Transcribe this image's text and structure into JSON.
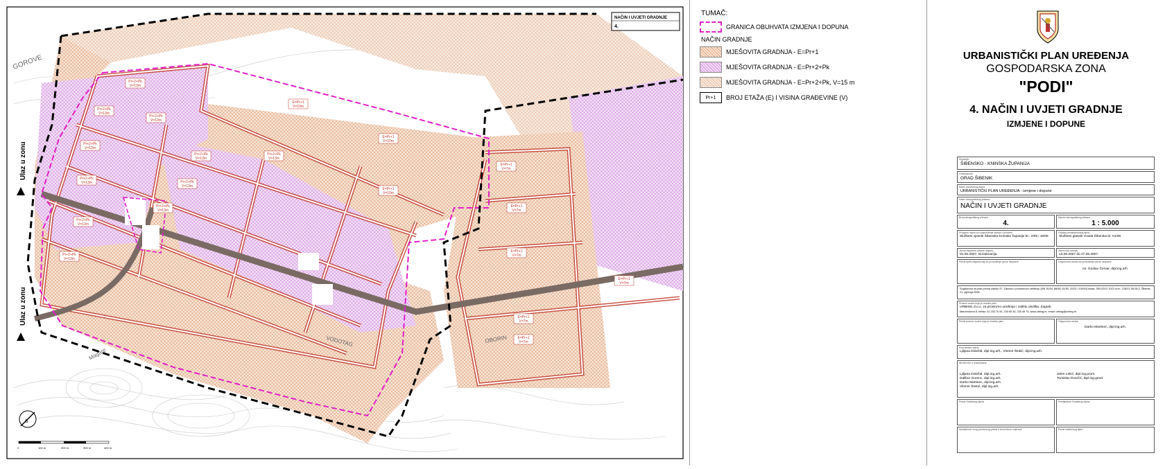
{
  "map": {
    "stamp": {
      "title": "NAČIN I UVJETI GRADNJE",
      "number": "4."
    },
    "road_labels": {
      "entry_top": "Ulaz u zonu",
      "entry_bottom": "Ulaz u zonu"
    },
    "place_labels": [
      "GOROVE",
      "Magare",
      "OBORIN",
      "VODOTAG"
    ],
    "zone_labels": [
      "Pr+2+Pk V=13m",
      "Pr+2+Pk V=13m",
      "Pr+2+Pk V=13m",
      "E=Pr+1 V=10m",
      "E=Pr+1 V=10m",
      "Pr+2+Pk V=13m",
      "Pr+2+Pk V=13m",
      "Pr+2+Pk V=13m",
      "E=Pr+1 V=10m",
      "Pr+2+Pk V=13m",
      "Pr+2+Pk V=13m",
      "Pr+2+Pk V=13m",
      "Pr+2+Pk V=13m",
      "Pr+2+Pk V=13m",
      "E=Pr+1 V=7m",
      "E=Pr+1 V=7m",
      "E=Pr+1 V=7m",
      "E=Pr+1 V=7m",
      "E=Pr+1 V=7m",
      "E=Pr+1 V=7m"
    ],
    "scale_labels": [
      "0",
      "100 m",
      "200 m",
      "300 m",
      "400 m"
    ],
    "north_label": "S"
  },
  "legend": {
    "title": "TUMAČ:",
    "boundary_label": "GRANICA OBUHVATA IZMJENA I DOPUNA",
    "section_label": "NAČIN GRADNJE",
    "items": [
      {
        "label": "MJEŠOVITA GRADNJA - E=Pr+1",
        "color": "#e6a47a"
      },
      {
        "label": "MJEŠOVITA GRADNJA - E=Pr+2+Pk",
        "color": "#d68fe0"
      },
      {
        "label": "MJEŠOVITA GRADNJA - E=Pr+2+Pk, V=15 m",
        "color": "#e6b99a"
      }
    ],
    "floors_badge": "Pr+1",
    "floors_label": "BROJ ETAŽA (E) I VISINA GRAĐEVINE (V)"
  },
  "title_block": {
    "line1": "URBANISTIČKI PLAN UREĐENJA",
    "line2": "GOSPODARSKA ZONA",
    "line3": "\"PODI\"",
    "line4": "4. NAČIN I UVJETI GRADNJE",
    "line5": "IZMJENE I DOPUNE",
    "rows": [
      {
        "caption": "Županija",
        "value": "ŠIBENSKO - KNINSKA ŽUPANIJA"
      },
      {
        "caption": "Grad/općina",
        "value": "GRAD ŠIBENIK"
      },
      {
        "caption": "Naziv prostornog plana",
        "value": "URBANISTIČKI PLAN UREĐENJA - izmjene i dopune"
      },
      {
        "caption": "Naziv kartografskog prikaza",
        "value": "NAČIN I UVJETI GRADNJE"
      }
    ],
    "number_caption": "Broj kartografskog prikaza",
    "number_value": "4.",
    "scale_caption": "Mjerilo kartografskog prikaza",
    "scale_value": "1 : 5.000",
    "decision_caption": "Program mjera za unapređenje stanja u prostoru",
    "decision_value": "Službeni vjesnik Šibensko-Kninske županije br.: 2/05 i 15/06",
    "publication_caption": "Odluka predstavničkog tijela",
    "publication_value": "Službeni glasnik Grada Šibenika br. 01/08",
    "public_debate_caption": "Javna rasprava (datum objave)",
    "public_debate_value": "01.06.2007. Sl.Dalmacija",
    "public_insight_caption": "Javni uvid održan",
    "public_insight_value": "13.06.2007 do 27.06.2007.",
    "stamp_caption": "Pečat tijela odgovornog za provođenje javne rasprave",
    "responsible_caption": "Odgovorna osoba za provođenje javne rasprave",
    "responsible_name": "mr. Gustav Červar, dipl.ing.arh.",
    "approval_text": "Suglasnost na plan prema članku 97. Zakona o prostornom uređenju (NN 30/94, 68/98, 61/00, 32/02 i 100/04) klasa: 350-02/07-01/3 ur.br.: 2182/1-05-08-2, Šibenik, 21. siječnja 2008.",
    "maker_caption": "Pravna osoba koja je izradila plan",
    "maker_name": "URBING d.o.o. za prostorno uređenje i zaštitu okoliša, Zagreb",
    "maker_address": "Marohnićeva 8, tel/fax: 01 230 70 00, 230 69 30, 230 45 74, www.urbing.hr, email: urbing@urbing.hr",
    "maker_stamp_caption": "Pečat pravne osobe koja je izradila plan",
    "maker_responsible_caption": "Odgovorna osoba",
    "maker_responsible_name": "Darko Martinec, dipl.ing.arh.",
    "coordinator_caption": "Koordinator plana",
    "coordinator_name": "Ljiljana Doležal, dipl.ing.arh., Vitomir Štokić, dipl.ing.arh.",
    "team_caption": "Stručni tim u izradi plana",
    "team_left": [
      "Ljiljana Doležal, dipl.ing.arh.",
      "Dalibor Gorenc, dipl.ing.arh.",
      "Darko Martinec, dipl.ing.arh.",
      "Vitomir Štokić, dipl.ing.arh."
    ],
    "team_right": [
      "Jelen Lekić, dipl.ing.prom.",
      "Tomislav Dvorčić, dipl.ing.geod."
    ],
    "council_stamp_caption": "Pečat Gradskog vijeća",
    "council_president_caption": "Predsjednik Gradskog vijeća",
    "authentic_caption": "Istovjetnost ovog prostornog plana s izvornikom ovjerava",
    "authentic_stamp_caption": "Pečat nadležnog tijela"
  }
}
